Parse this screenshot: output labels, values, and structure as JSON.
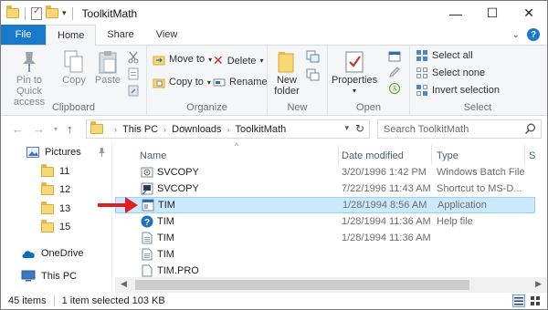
{
  "window": {
    "title": "ToolkitMath",
    "qat_dropdown": "▾",
    "buttons": {
      "minimize": "—",
      "maximize": "☐",
      "close": "✕"
    }
  },
  "tabs": {
    "file": "File",
    "items": [
      "Home",
      "Share",
      "View"
    ],
    "active": "Home",
    "collapse": "⌄",
    "help": "?"
  },
  "ribbon": {
    "clipboard": {
      "label": "Clipboard",
      "pin": "Pin to Quick access",
      "pin_line1": "Pin to Quick",
      "pin_line2": "access",
      "copy": "Copy",
      "paste": "Paste"
    },
    "organize": {
      "label": "Organize",
      "move_to": "Move to",
      "copy_to": "Copy to",
      "delete": "Delete",
      "rename": "Rename"
    },
    "new": {
      "label": "New",
      "new_folder_line1": "New",
      "new_folder_line2": "folder"
    },
    "open": {
      "label": "Open",
      "properties": "Properties"
    },
    "select": {
      "label": "Select",
      "select_all": "Select all",
      "select_none": "Select none",
      "invert": "Invert selection"
    }
  },
  "address": {
    "crumbs": [
      "This PC",
      "Downloads",
      "ToolkitMath"
    ],
    "search_placeholder": "Search ToolkitMath"
  },
  "nav_pane": {
    "items": [
      {
        "label": "Pictures",
        "icon": "pictures-icon",
        "pinned": true
      },
      {
        "label": "11",
        "icon": "folder-icon"
      },
      {
        "label": "12",
        "icon": "folder-icon"
      },
      {
        "label": "13",
        "icon": "folder-icon"
      },
      {
        "label": "15",
        "icon": "folder-icon"
      },
      {
        "label": "OneDrive",
        "icon": "onedrive-icon"
      },
      {
        "label": "This PC",
        "icon": "computer-icon"
      }
    ],
    "pin_glyph": "📌"
  },
  "file_list": {
    "columns": {
      "name": "Name",
      "date": "Date modified",
      "type": "Type",
      "size": "S"
    },
    "rows": [
      {
        "name": "SVCOPY",
        "date": "3/20/1996 1:42 PM",
        "type": "Windows Batch File",
        "icon": "batch-file-icon",
        "selected": false
      },
      {
        "name": "SVCOPY",
        "date": "7/22/1996 11:43 AM",
        "type": "Shortcut to MS-D...",
        "icon": "shortcut-icon",
        "selected": false
      },
      {
        "name": "TIM",
        "date": "1/28/1994 8:56 AM",
        "type": "Application",
        "icon": "application-icon",
        "selected": true
      },
      {
        "name": "TIM",
        "date": "1/28/1994 11:36 AM",
        "type": "Help file",
        "icon": "help-file-icon",
        "selected": false
      },
      {
        "name": "TIM",
        "date": "1/28/1994 11:36 AM",
        "type": "",
        "icon": "document-icon",
        "selected": false
      },
      {
        "name": "TIM",
        "date": "",
        "type": "",
        "icon": "document-icon",
        "selected": false
      },
      {
        "name": "TIM.PRO",
        "date": "",
        "type": "",
        "icon": "document-icon",
        "selected": false
      }
    ]
  },
  "status": {
    "count": "45 items",
    "selection": "1 item selected  103 KB"
  },
  "colors": {
    "file_tab": "#1979ca",
    "selected_row": "#cce8ff",
    "arrow": "#e02020",
    "folder": "#f8d775"
  }
}
